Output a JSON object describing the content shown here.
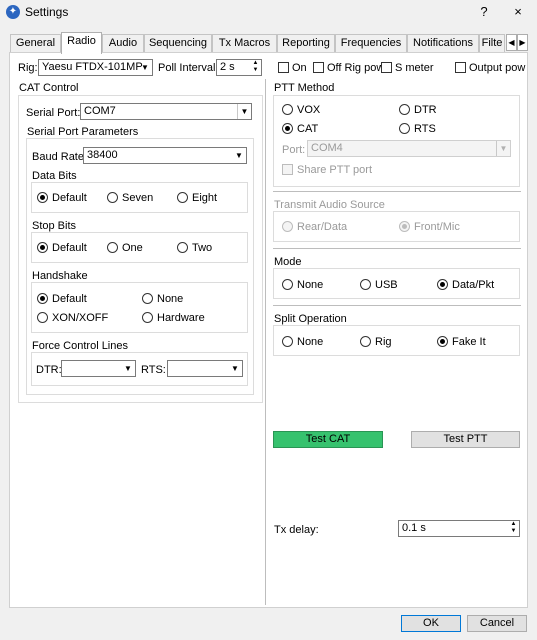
{
  "window": {
    "title": "Settings",
    "help": "?",
    "close": "×"
  },
  "tabs": [
    {
      "label": "General"
    },
    {
      "label": "Radio"
    },
    {
      "label": "Audio"
    },
    {
      "label": "Sequencing"
    },
    {
      "label": "Tx Macros"
    },
    {
      "label": "Reporting"
    },
    {
      "label": "Frequencies"
    },
    {
      "label": "Notifications"
    },
    {
      "label": "Filte"
    }
  ],
  "tab_scroll": {
    "left": "◀",
    "right": "▶"
  },
  "top_row": {
    "rig_label": "Rig:",
    "rig_value": "Yaesu FTDX-101MP",
    "poll_label": "Poll Interval:",
    "poll_value": "2 s",
    "on_label": "On",
    "off_rig_pow_label": "Off Rig pow",
    "s_meter_label": "S meter",
    "output_pow_label": "Output pow"
  },
  "cat": {
    "title": "CAT Control",
    "serial_port_label": "Serial Port:",
    "serial_port_value": "COM7",
    "params_title": "Serial Port Parameters",
    "baud_label": "Baud Rate:",
    "baud_value": "38400",
    "data_bits_title": "Data Bits",
    "data_bits": [
      "Default",
      "Seven",
      "Eight"
    ],
    "stop_bits_title": "Stop Bits",
    "stop_bits": [
      "Default",
      "One",
      "Two"
    ],
    "handshake_title": "Handshake",
    "handshake": [
      "Default",
      "None",
      "XON/XOFF",
      "Hardware"
    ],
    "force_title": "Force Control Lines",
    "dtr_label": "DTR:",
    "dtr_value": "",
    "rts_label": "RTS:",
    "rts_value": ""
  },
  "ptt": {
    "title": "PTT Method",
    "options": [
      "VOX",
      "DTR",
      "CAT",
      "RTS"
    ],
    "port_label": "Port:",
    "port_value": "COM4",
    "share_label": "Share PTT port"
  },
  "tx_audio": {
    "title": "Transmit Audio Source",
    "options": [
      "Rear/Data",
      "Front/Mic"
    ]
  },
  "mode": {
    "title": "Mode",
    "options": [
      "None",
      "USB",
      "Data/Pkt"
    ]
  },
  "split": {
    "title": "Split Operation",
    "options": [
      "None",
      "Rig",
      "Fake It"
    ]
  },
  "tests": {
    "test_cat": "Test CAT",
    "test_ptt": "Test PTT"
  },
  "tx_delay": {
    "label": "Tx delay:",
    "value": "0.1 s"
  },
  "footer": {
    "ok": "OK",
    "cancel": "Cancel"
  },
  "colors": {
    "test_cat_active": "#36c26e",
    "accent": "#0078d7"
  }
}
